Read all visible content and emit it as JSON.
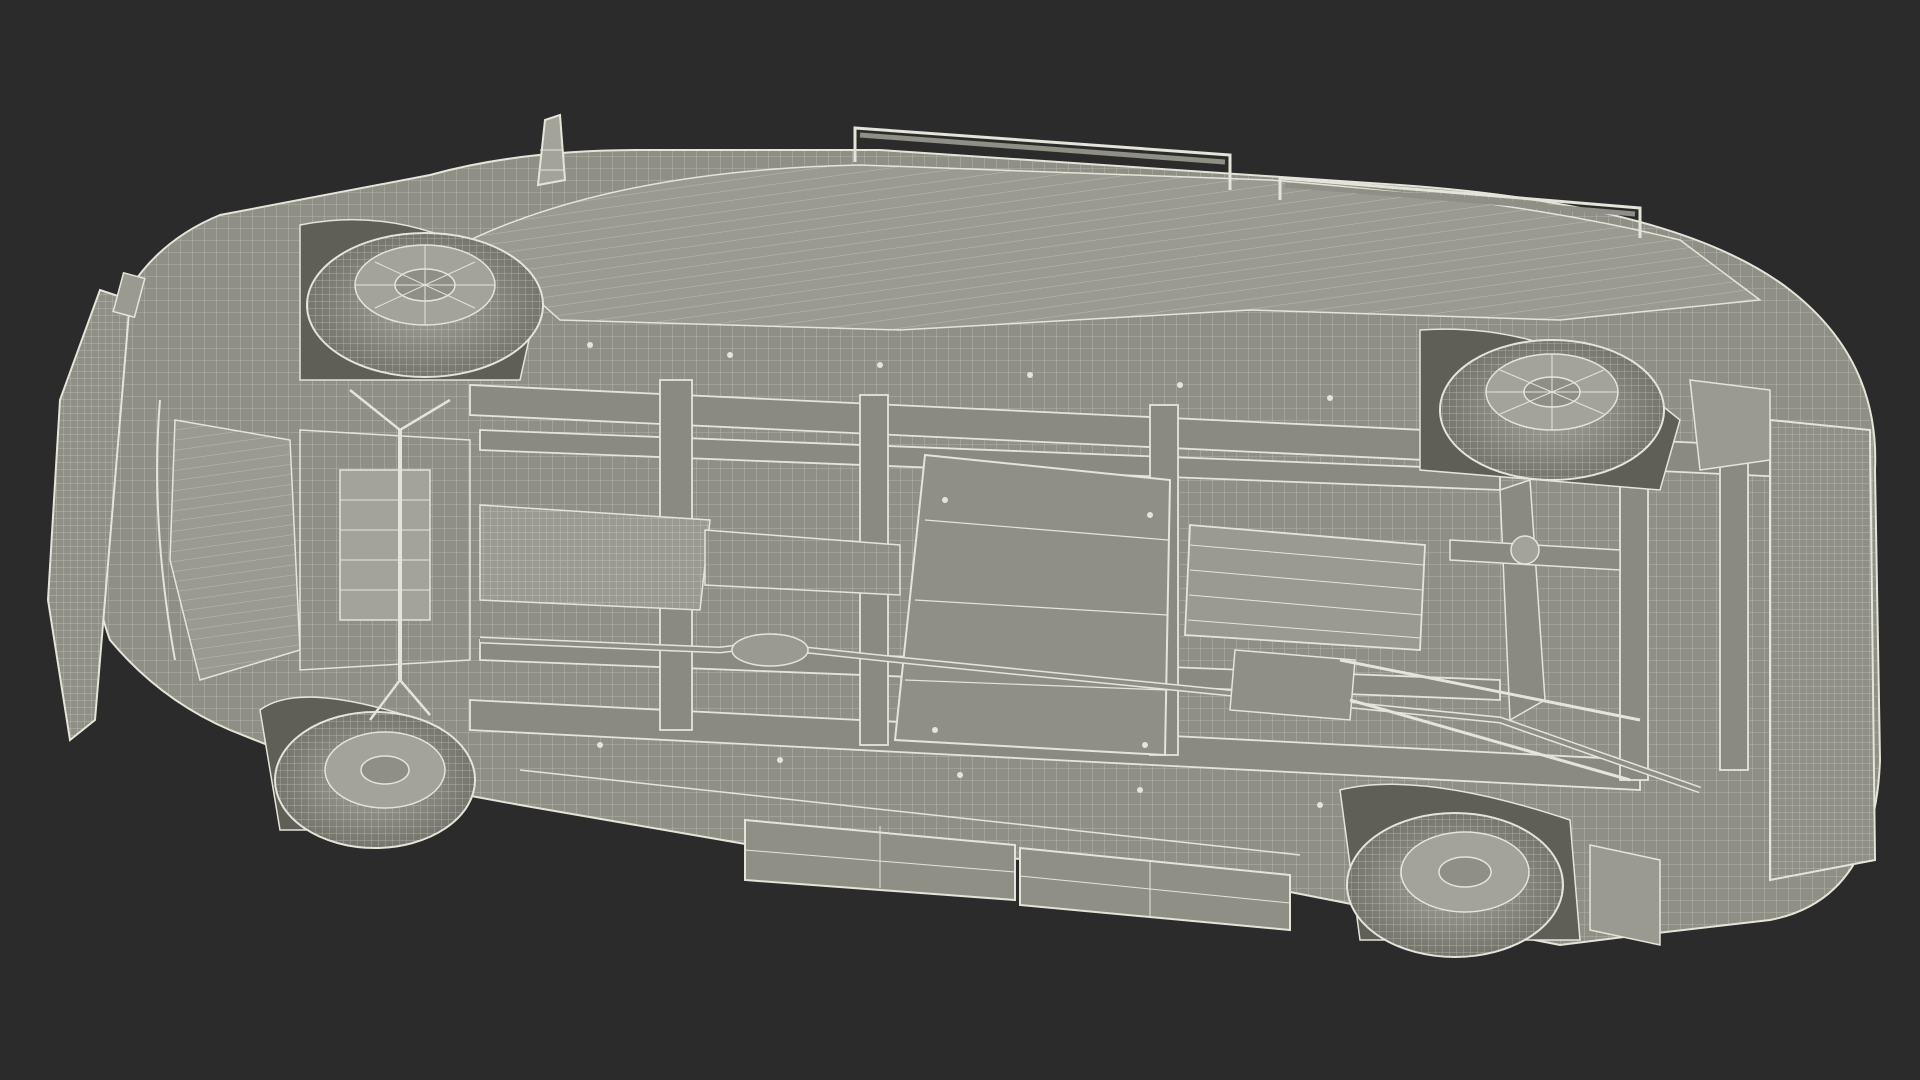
{
  "image": {
    "subject": "wireframe-render-of-van-underside",
    "colors": {
      "background": "#2b2b2b",
      "body": "#8f8f86",
      "body_light": "#a3a399",
      "body_dark": "#6e6e66",
      "wire": "#e4e4d8",
      "wire_faint": "#c9c9bd",
      "shadow": "#4a4a45"
    }
  }
}
